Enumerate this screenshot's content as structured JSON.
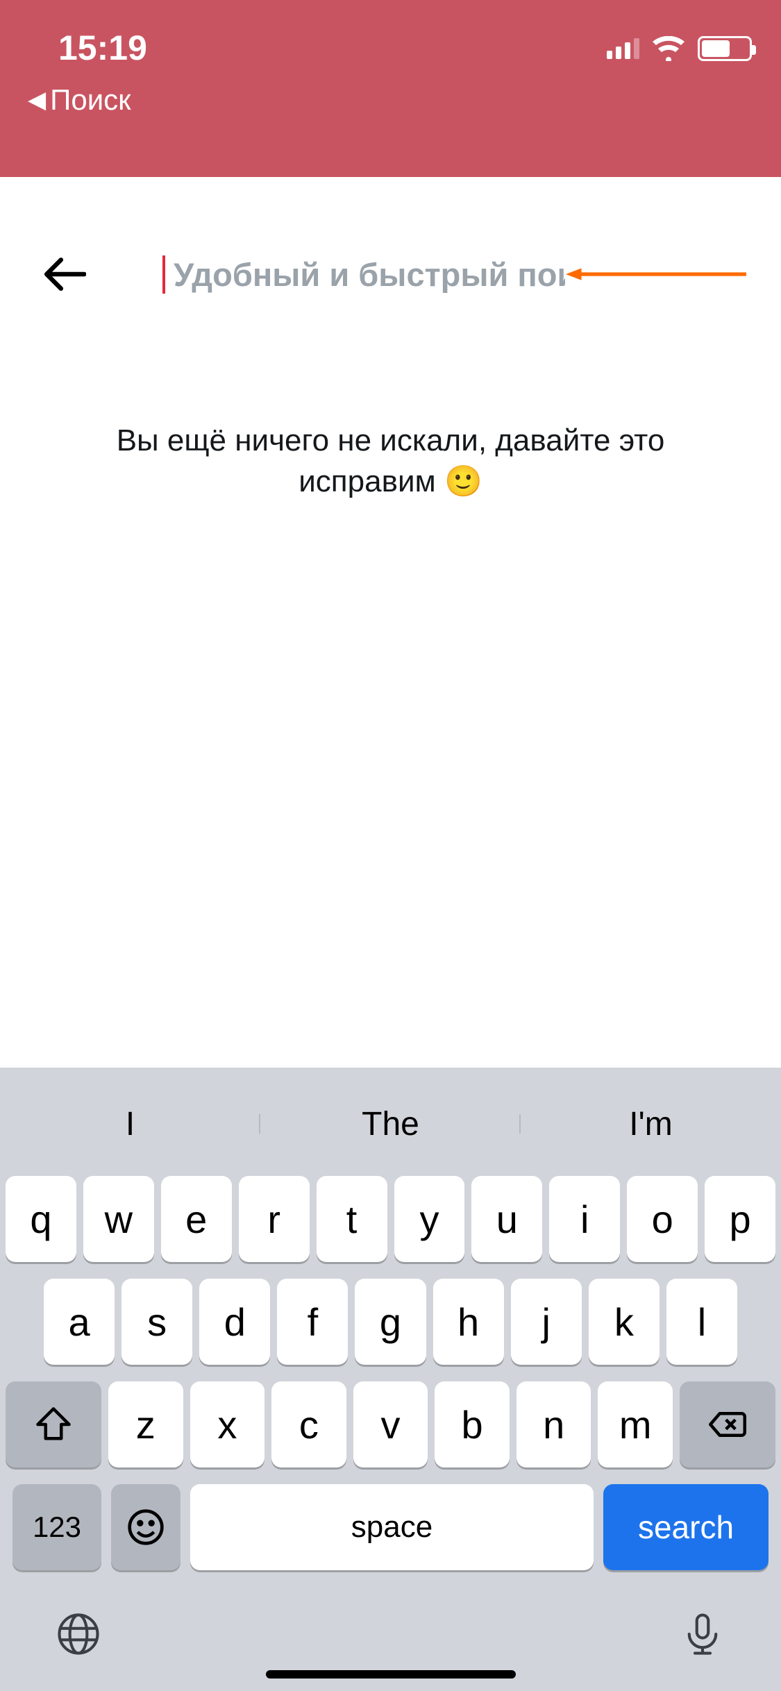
{
  "statusbar": {
    "time": "15:19",
    "back_app_label": "Поиск"
  },
  "search": {
    "placeholder": "Удобный и быстрый поиск",
    "value": ""
  },
  "empty_state": {
    "message": "Вы ещё ничего не искали, давайте это исправим 🙂"
  },
  "keyboard": {
    "suggestions": [
      "I",
      "The",
      "I'm"
    ],
    "row1": [
      "q",
      "w",
      "e",
      "r",
      "t",
      "y",
      "u",
      "i",
      "o",
      "p"
    ],
    "row2": [
      "a",
      "s",
      "d",
      "f",
      "g",
      "h",
      "j",
      "k",
      "l"
    ],
    "row3": [
      "z",
      "x",
      "c",
      "v",
      "b",
      "n",
      "m"
    ],
    "numeric_label": "123",
    "space_label": "space",
    "search_label": "search"
  }
}
